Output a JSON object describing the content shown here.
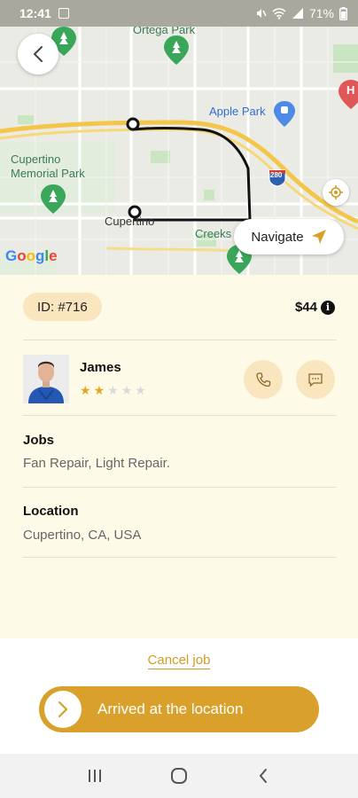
{
  "status_bar": {
    "time": "12:41",
    "battery": "71%"
  },
  "map": {
    "labels": {
      "ortega_park": "Ortega Park",
      "apple_park": "Apple Park",
      "cupertino_memorial_park": "Cupertino\nMemorial Park",
      "cupertino": "Cupertino",
      "creeks": "Creeks",
      "highway": "280",
      "hospital_marker": "H"
    },
    "navigate_label": "Navigate",
    "google_logo": "Google"
  },
  "job": {
    "id_label": "ID: #716",
    "price": "$44",
    "info_glyph": "i"
  },
  "worker": {
    "name": "James",
    "rating": 2,
    "max_rating": 5
  },
  "jobs_section": {
    "title": "Jobs",
    "value": "Fan Repair, Light Repair."
  },
  "location_section": {
    "title": "Location",
    "value": "Cupertino, CA, USA"
  },
  "actions": {
    "cancel_label": "Cancel job",
    "arrived_label": "Arrived at the location"
  },
  "colors": {
    "accent": "#d9a12b",
    "badge_bg": "#f9e6bf",
    "background": "#fdfbe8",
    "route": "#111111",
    "highway": "#f3c64a"
  },
  "icons": {
    "back": "chevron-left-icon",
    "locate": "crosshair-icon",
    "navigate": "navigation-arrow-icon",
    "info": "info-icon",
    "call": "phone-icon",
    "chat": "chat-bubble-icon",
    "slide": "chevron-right-icon",
    "nav_recents": "recents-icon",
    "nav_home": "home-icon",
    "nav_back": "back-icon"
  }
}
